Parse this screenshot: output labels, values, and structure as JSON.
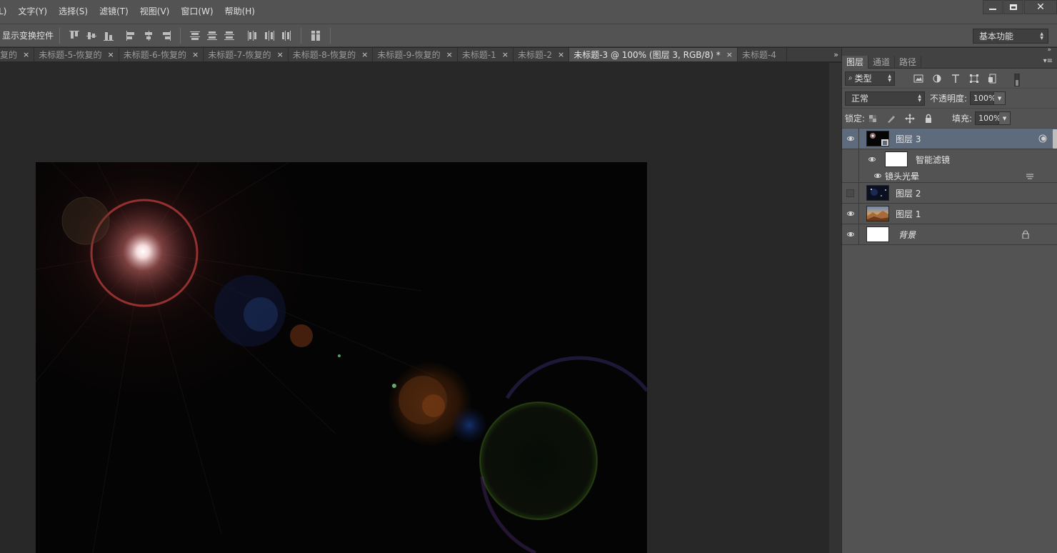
{
  "menu": {
    "items": [
      "L)",
      "文字(Y)",
      "选择(S)",
      "滤镜(T)",
      "视图(V)",
      "窗口(W)",
      "帮助(H)"
    ]
  },
  "window_controls": [
    "minimize-icon",
    "maximize-icon",
    "close-icon"
  ],
  "options_bar": {
    "show_transform_controls": "显示变换控件",
    "workspace": "基本功能"
  },
  "tabs": [
    {
      "label": "复的",
      "active": false
    },
    {
      "label": "未标题-5-恢复的",
      "active": false
    },
    {
      "label": "未标题-6-恢复的",
      "active": false
    },
    {
      "label": "未标题-7-恢复的",
      "active": false
    },
    {
      "label": "未标题-8-恢复的",
      "active": false
    },
    {
      "label": "未标题-9-恢复的",
      "active": false
    },
    {
      "label": "未标题-1",
      "active": false
    },
    {
      "label": "未标题-2",
      "active": false
    },
    {
      "label": "未标题-3 @ 100% (图层 3, RGB/8) *",
      "active": true
    },
    {
      "label": "未标题-4",
      "active": false
    }
  ],
  "tab_close": "×",
  "tab_overflow": "»",
  "panel": {
    "tabs": [
      "图层",
      "通道",
      "路径"
    ],
    "filter_kind": "类型",
    "blend_mode": "正常",
    "opacity_label": "不透明度:",
    "opacity_value": "100%",
    "lock_label": "锁定:",
    "fill_label": "填充:",
    "fill_value": "100%"
  },
  "layers": [
    {
      "name": "图层 3",
      "visible": true,
      "selected": true,
      "thumb": "dark-flare"
    },
    {
      "name": "智能滤镜",
      "sub": "smart-filter"
    },
    {
      "name": "镜头光晕",
      "sub": "filter-item"
    },
    {
      "name": "图层 2",
      "visible": false,
      "selected": false,
      "thumb": "dark-stars"
    },
    {
      "name": "图层 1",
      "visible": true,
      "selected": false,
      "thumb": "photo"
    },
    {
      "name": "背景",
      "visible": true,
      "selected": false,
      "thumb": "white",
      "locked": true
    }
  ],
  "colors": {
    "ui_bg": "#535353",
    "canvas_bg": "#282828",
    "selected_layer": "#5e6b7c"
  }
}
